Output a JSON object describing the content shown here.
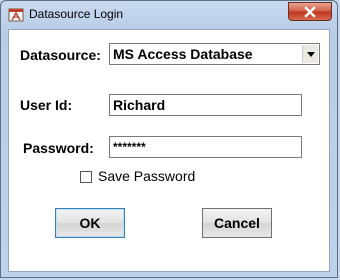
{
  "window": {
    "title": "Datasource Login",
    "close_icon": "close-icon"
  },
  "form": {
    "datasource_label": "Datasource:",
    "datasource_value": "MS Access Database",
    "userid_label": "User Id:",
    "userid_value": "Richard",
    "password_label": "Password:",
    "password_value": "*******",
    "save_password_label": "Save Password",
    "save_password_checked": false
  },
  "buttons": {
    "ok_label": "OK",
    "cancel_label": "Cancel"
  },
  "colors": {
    "titlebar": "#c9daf0",
    "close_button": "#c0371d",
    "client_background": "#ffffff"
  }
}
